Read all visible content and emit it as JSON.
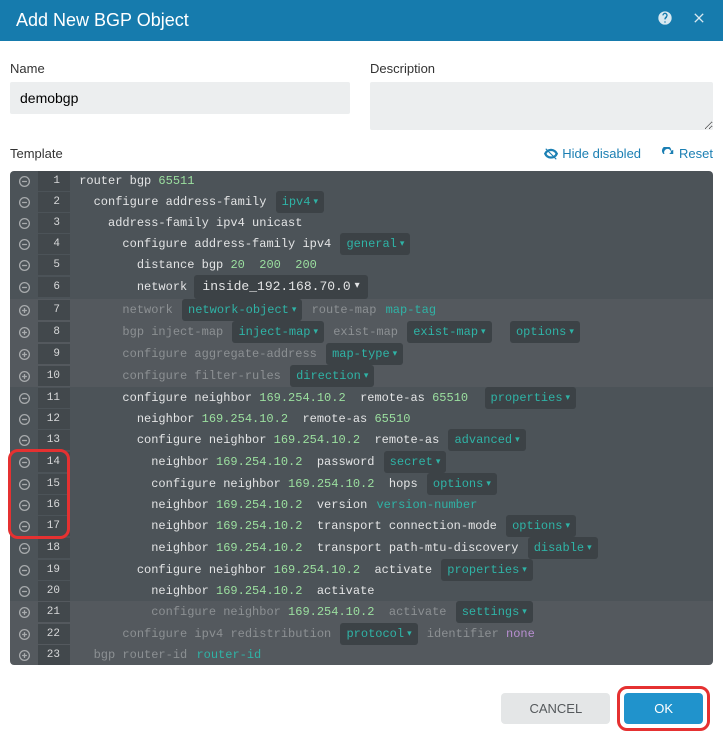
{
  "header": {
    "title": "Add New BGP Object"
  },
  "form": {
    "name_label": "Name",
    "name_value": "demobgp",
    "desc_label": "Description",
    "desc_value": ""
  },
  "template_bar": {
    "label": "Template",
    "hide_label": "Hide disabled",
    "reset_label": "Reset"
  },
  "lines": [
    {
      "n": 1,
      "icon": "minus",
      "indent": 0,
      "tokens": [
        [
          "kw",
          "router bgp "
        ],
        [
          "num",
          "65511"
        ]
      ]
    },
    {
      "n": 2,
      "icon": "minus",
      "indent": 1,
      "tokens": [
        [
          "kw",
          "configure address-family "
        ],
        [
          "chip",
          "ipv4"
        ]
      ]
    },
    {
      "n": 3,
      "icon": "minus",
      "indent": 2,
      "tokens": [
        [
          "kw",
          "address-family ipv4 unicast"
        ]
      ]
    },
    {
      "n": 4,
      "icon": "minus",
      "indent": 3,
      "tokens": [
        [
          "kw",
          "configure address-family ipv4 "
        ],
        [
          "chip",
          "general"
        ]
      ]
    },
    {
      "n": 5,
      "icon": "minus",
      "indent": 4,
      "tokens": [
        [
          "kw",
          "distance bgp "
        ],
        [
          "num",
          "20"
        ],
        [
          "kw",
          "  "
        ],
        [
          "num",
          "200"
        ],
        [
          "kw",
          "  "
        ],
        [
          "num",
          "200"
        ]
      ]
    },
    {
      "n": 6,
      "icon": "minus",
      "indent": 4,
      "tokens": [
        [
          "kw",
          "network "
        ],
        [
          "netpill",
          "inside_192.168.70.0"
        ]
      ]
    },
    {
      "n": 7,
      "icon": "plus",
      "indent": 3,
      "disabled": true,
      "tokens": [
        [
          "dis",
          "network "
        ],
        [
          "chipd",
          "network-object"
        ],
        [
          "dis",
          " route-map "
        ],
        [
          "tag",
          "map-tag"
        ]
      ]
    },
    {
      "n": 8,
      "icon": "plus",
      "indent": 3,
      "disabled": true,
      "tokens": [
        [
          "dis",
          "bgp inject-map "
        ],
        [
          "chipd",
          "inject-map"
        ],
        [
          "dis",
          " exist-map "
        ],
        [
          "chipd",
          "exist-map"
        ],
        [
          "kw",
          "  "
        ],
        [
          "chipd",
          "options"
        ]
      ]
    },
    {
      "n": 9,
      "icon": "plus",
      "indent": 3,
      "disabled": true,
      "tokens": [
        [
          "dis",
          "configure aggregate-address "
        ],
        [
          "chipd",
          "map-type"
        ]
      ]
    },
    {
      "n": 10,
      "icon": "plus",
      "indent": 3,
      "disabled": true,
      "tokens": [
        [
          "dis",
          "configure filter-rules "
        ],
        [
          "chipd",
          "direction"
        ]
      ]
    },
    {
      "n": 11,
      "icon": "minus",
      "indent": 3,
      "tokens": [
        [
          "kw",
          "configure neighbor "
        ],
        [
          "ip",
          "169.254.10.2"
        ],
        [
          "kw",
          "  remote-as "
        ],
        [
          "num",
          "65510"
        ],
        [
          "kw",
          "  "
        ],
        [
          "chip",
          "properties"
        ]
      ]
    },
    {
      "n": 12,
      "icon": "minus",
      "indent": 4,
      "tokens": [
        [
          "kw",
          "neighbor "
        ],
        [
          "ip",
          "169.254.10.2"
        ],
        [
          "kw",
          "  remote-as "
        ],
        [
          "num",
          "65510"
        ]
      ]
    },
    {
      "n": 13,
      "icon": "minus",
      "indent": 4,
      "tokens": [
        [
          "kw",
          "configure neighbor "
        ],
        [
          "ip",
          "169.254.10.2"
        ],
        [
          "kw",
          "  remote-as "
        ],
        [
          "chip",
          "advanced"
        ]
      ]
    },
    {
      "n": 14,
      "icon": "minus",
      "indent": 5,
      "tokens": [
        [
          "kw",
          "neighbor "
        ],
        [
          "ip",
          "169.254.10.2"
        ],
        [
          "kw",
          "  password "
        ],
        [
          "chip",
          "secret"
        ]
      ]
    },
    {
      "n": 15,
      "icon": "minus",
      "indent": 5,
      "tokens": [
        [
          "kw",
          "configure neighbor "
        ],
        [
          "ip",
          "169.254.10.2"
        ],
        [
          "kw",
          "  hops "
        ],
        [
          "chip",
          "options"
        ]
      ]
    },
    {
      "n": 16,
      "icon": "minus",
      "indent": 5,
      "tokens": [
        [
          "kw",
          "neighbor "
        ],
        [
          "ip",
          "169.254.10.2"
        ],
        [
          "kw",
          "  version "
        ],
        [
          "tag",
          "version-number"
        ]
      ]
    },
    {
      "n": 17,
      "icon": "minus",
      "indent": 5,
      "tokens": [
        [
          "kw",
          "neighbor "
        ],
        [
          "ip",
          "169.254.10.2"
        ],
        [
          "kw",
          "  transport connection-mode "
        ],
        [
          "chip",
          "options"
        ]
      ]
    },
    {
      "n": 18,
      "icon": "minus",
      "indent": 5,
      "tokens": [
        [
          "kw",
          "neighbor "
        ],
        [
          "ip",
          "169.254.10.2"
        ],
        [
          "kw",
          "  transport path-mtu-discovery "
        ],
        [
          "chipd",
          "disable"
        ]
      ]
    },
    {
      "n": 19,
      "icon": "minus",
      "indent": 4,
      "tokens": [
        [
          "kw",
          "configure neighbor "
        ],
        [
          "ip",
          "169.254.10.2"
        ],
        [
          "kw",
          "  activate "
        ],
        [
          "chip",
          "properties"
        ]
      ]
    },
    {
      "n": 20,
      "icon": "minus",
      "indent": 5,
      "tokens": [
        [
          "kw",
          "neighbor "
        ],
        [
          "ip",
          "169.254.10.2"
        ],
        [
          "kw",
          "  activate"
        ]
      ]
    },
    {
      "n": 21,
      "icon": "plus",
      "indent": 5,
      "disabled": true,
      "tokens": [
        [
          "dis",
          "configure neighbor "
        ],
        [
          "ip",
          "169.254.10.2"
        ],
        [
          "dis",
          "  activate "
        ],
        [
          "chipd",
          "settings"
        ]
      ]
    },
    {
      "n": 22,
      "icon": "plus",
      "indent": 3,
      "disabled": true,
      "tokens": [
        [
          "dis",
          "configure ipv4 redistribution "
        ],
        [
          "chipd",
          "protocol"
        ],
        [
          "dis",
          " identifier "
        ],
        [
          "none",
          "none"
        ]
      ]
    },
    {
      "n": 23,
      "icon": "plus",
      "indent": 1,
      "disabled": true,
      "tokens": [
        [
          "dis",
          "bgp router-id "
        ],
        [
          "tag",
          "router-id"
        ]
      ]
    }
  ],
  "footer": {
    "cancel": "CANCEL",
    "ok": "OK"
  }
}
